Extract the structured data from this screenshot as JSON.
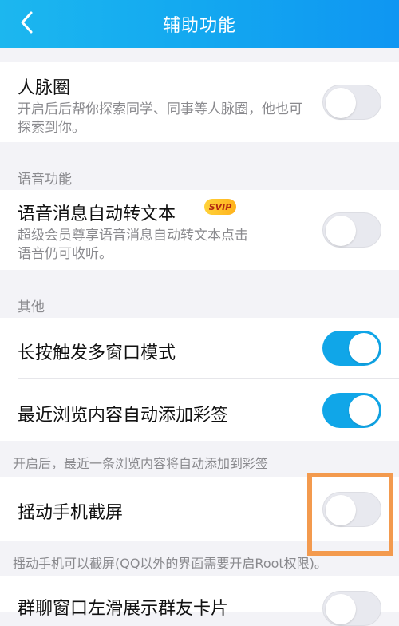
{
  "header": {
    "title": "辅助功能",
    "back_icon": "chevron-left-icon"
  },
  "items": {
    "renmai": {
      "title": "人脉圈",
      "desc": "开启后后帮你探索同学、同事等人脉圈，他也可探索到你。",
      "enabled": false
    },
    "voice_to_text": {
      "title": "语音消息自动转文本",
      "badge": "SVIP",
      "desc": "超级会员尊享语音消息自动转文本点击语音仍可收听。",
      "enabled": false
    },
    "multi_window": {
      "title": "长按触发多窗口模式",
      "enabled": true
    },
    "auto_tag": {
      "title": "最近浏览内容自动添加彩签",
      "enabled": true
    },
    "shake_screenshot": {
      "title": "摇动手机截屏",
      "enabled": false
    },
    "group_card": {
      "title": "群聊窗口左滑展示群友卡片",
      "enabled": false
    }
  },
  "sections": {
    "voice": "语音功能",
    "other": "其他"
  },
  "notes": {
    "auto_tag_note": "开启后，最近一条浏览内容将自动添加到彩签",
    "shake_note": "摇动手机可以截屏(QQ以外的界面需要开启Root权限)。"
  },
  "colors": {
    "accent": "#10a6e8",
    "highlight": "#f39a4e"
  }
}
